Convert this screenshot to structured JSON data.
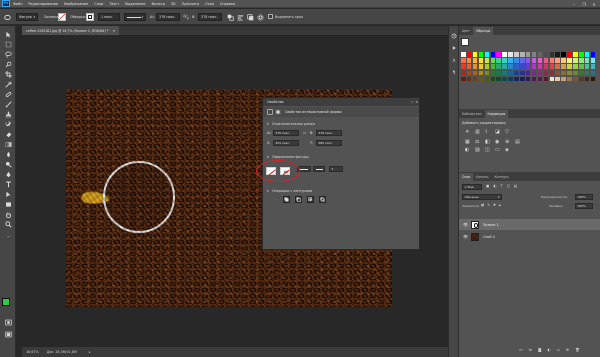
{
  "menu": [
    "Файл",
    "Редактирование",
    "Изображение",
    "Слои",
    "Текст",
    "Выделение",
    "Фильтр",
    "3D",
    "Просмотр",
    "Окно",
    "Справка"
  ],
  "options_bar": {
    "tool_mode": "Фигура",
    "fill_label": "Заливка:",
    "stroke_label": "Обводка:",
    "stroke_width": "1 пикс.",
    "w_label": "Ш:",
    "w_value": "378 пикс.",
    "h_label": "В:",
    "h_value": "378 пикс.",
    "align_label": "Выровнять края"
  },
  "document_tab": "coffee-1345181.jpg @ 16,7% (Эллипс 1, RGB/8#) *",
  "status": {
    "zoom": "16,67%",
    "doc": "Док: 28,5М/41,8М"
  },
  "properties": {
    "tab_title": "Свойства",
    "subtitle": "Свойства интерактивной формы",
    "section_size": "Ограничительная рамка",
    "w_label": "Ш:",
    "w_value": "378 пикс.",
    "h_label": "В:",
    "h_value": "378 пикс.",
    "x_label": "X:",
    "x_value": "404 пикс.",
    "y_label": "Y:",
    "y_value": "680 пикс.",
    "section_appearance": "Оформление фигуры",
    "section_ops": "Операции с контурами"
  },
  "swatches_panel": {
    "tabs": [
      "Цвет",
      "Образцы"
    ],
    "colors": [
      [
        "#ffffff",
        "#ff0000",
        "#ffff00",
        "#00ff00",
        "#00ffff",
        "#0000ff",
        "#ff00ff",
        "#ffffff",
        "#e6e6e6",
        "#cccccc",
        "#b3b3b3",
        "#999999",
        "#808080",
        "#666666",
        "#4d4d4d",
        "#333333",
        "#1a1a1a",
        "#000000",
        "#ff0000",
        "#ffff00",
        "#00ff00",
        "#00ffff",
        "#0000ff"
      ],
      [
        "#ff6a4a",
        "#ff8a3a",
        "#ffb03a",
        "#ffe03a",
        "#c8e84a",
        "#6ad85a",
        "#3ad08a",
        "#3ad0c8",
        "#3ab0e8",
        "#3a88e8",
        "#5a6ae8",
        "#8a5ae8",
        "#c85ae8",
        "#e85ac8",
        "#e85a8a",
        "#ff7a7a",
        "#ffa07a",
        "#ffc87a",
        "#fff07a",
        "#d0f07a",
        "#8ae87a",
        "#7ae8b0",
        "#7ae8e8"
      ],
      [
        "#e83a2a",
        "#e8602a",
        "#e8902a",
        "#e8c82a",
        "#a8c82a",
        "#48b83a",
        "#2aa86a",
        "#2aa8a0",
        "#2a88c8",
        "#2a60c8",
        "#3a48c8",
        "#6a3ac8",
        "#a83ac8",
        "#c83aa8",
        "#c83a6a",
        "#d04a4a",
        "#d0704a",
        "#d0a04a",
        "#d0d04a",
        "#a0d04a",
        "#60c04a",
        "#4ac090",
        "#4ab0c0"
      ],
      [
        "#a82a1a",
        "#a8481a",
        "#a8681a",
        "#a8901a",
        "#789018",
        "#2a7a28",
        "#1a784a",
        "#1a7870",
        "#1a6090",
        "#1a4090",
        "#2a3090",
        "#482890",
        "#782890",
        "#902878",
        "#90284a",
        "#8a3030",
        "#8a5030",
        "#8a7030",
        "#8a8a30",
        "#6a8a30",
        "#3a7a30",
        "#307a60",
        "#307080"
      ],
      [
        "#6a1a10",
        "#6a2e10",
        "#6a4210",
        "#6a5a10",
        "#4a5a10",
        "#1a4a18",
        "#10482e",
        "#104846",
        "#103c5a",
        "#10285a",
        "#1a1e5a",
        "#2e185a",
        "#4a185a",
        "#5a184a",
        "#5a182e",
        "#fbe3c8",
        "#e8c8a0",
        "#c8a078",
        "#a07850",
        "#785838",
        "#583c20",
        "#3c2810",
        "#281808"
      ]
    ]
  },
  "adjust_panel": {
    "tabs": [
      "Библиотеки",
      "Коррекция"
    ],
    "title": "Добавить корректировку"
  },
  "layers_panel": {
    "tabs": [
      "Слои",
      "Каналы",
      "Контуры"
    ],
    "kind_label": "Вид",
    "blend_mode": "Обычные",
    "opacity_label": "Непрозрачность:",
    "opacity_value": "100%",
    "lock_label": "Закрепить:",
    "fill_label": "Заливка:",
    "fill_value": "100%",
    "layers": [
      {
        "name": "Эллипс 1",
        "visible": true,
        "selected": true
      },
      {
        "name": "Слой 0",
        "visible": true,
        "selected": false
      }
    ]
  },
  "colors": {
    "foreground": "#2ecc40",
    "background": "#ffffff",
    "circle_stroke": "#e8e8e8",
    "highlight_ring": "#e02020"
  }
}
